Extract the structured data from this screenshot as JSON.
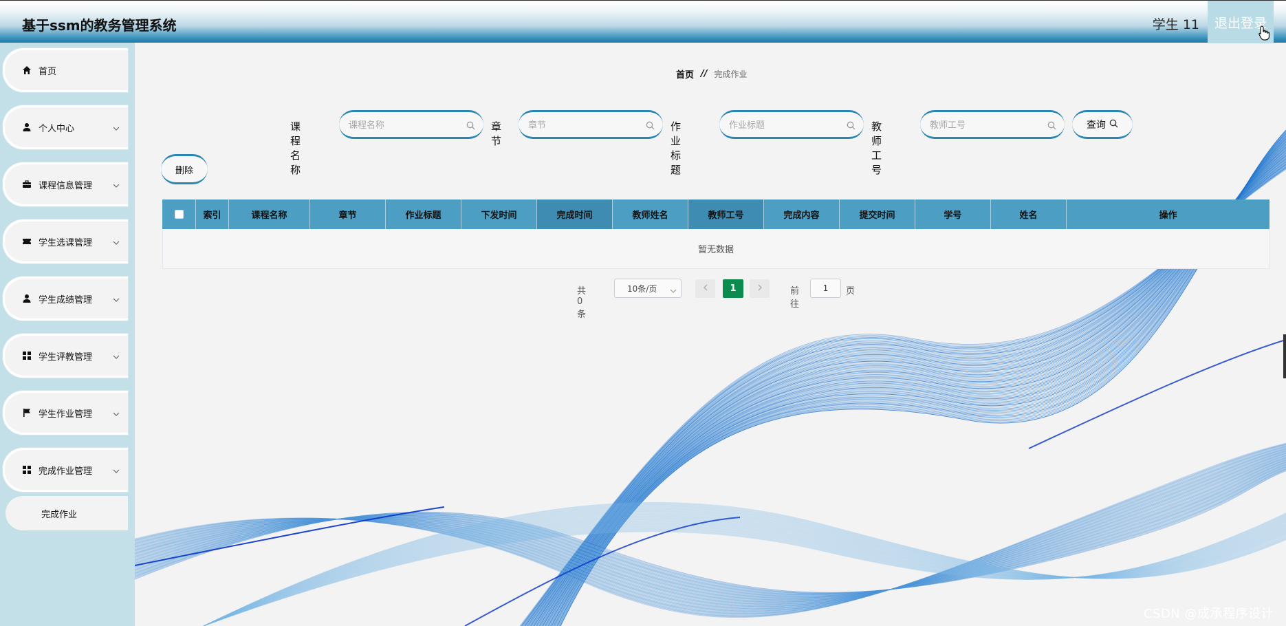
{
  "header": {
    "title": "基于ssm的教务管理系统",
    "user": "学生 11",
    "logout": "退出登录"
  },
  "sidebar": {
    "items": [
      {
        "label": "首页",
        "icon": "home-icon"
      },
      {
        "label": "个人中心",
        "icon": "user-icon"
      },
      {
        "label": "课程信息管理",
        "icon": "briefcase-icon"
      },
      {
        "label": "学生选课管理",
        "icon": "ticket-icon"
      },
      {
        "label": "学生成绩管理",
        "icon": "user-icon"
      },
      {
        "label": "学生评教管理",
        "icon": "grid-icon"
      },
      {
        "label": "学生作业管理",
        "icon": "flag-icon"
      },
      {
        "label": "完成作业管理",
        "icon": "grid-icon"
      }
    ],
    "submenu": {
      "label": "完成作业"
    }
  },
  "breadcrumb": {
    "home": "首页",
    "sep": "//",
    "current": "完成作业"
  },
  "search": {
    "course_label": "课程名称",
    "course_placeholder": "课程名称",
    "chapter_label": "章节",
    "chapter_placeholder": "章节",
    "title_label": "作业标题",
    "title_placeholder": "作业标题",
    "teacher_label": "教师工号",
    "teacher_placeholder": "教师工号",
    "query": "查询"
  },
  "actions": {
    "delete": "删除"
  },
  "table": {
    "columns": [
      "索引",
      "课程名称",
      "章节",
      "作业标题",
      "下发时间",
      "完成时间",
      "教师姓名",
      "教师工号",
      "完成内容",
      "提交时间",
      "学号",
      "姓名",
      "操作"
    ],
    "empty": "暂无数据"
  },
  "pagination": {
    "total": "共 0 条",
    "page_size": "10条/页",
    "current_page": "1",
    "goto_label": "前往",
    "goto_value": "1",
    "page_unit": "页"
  },
  "watermark": "CSDN @成承程序设计",
  "colors": {
    "accent": "#2a86b3",
    "table_header": "#4c9fc3",
    "active_page": "#0c8b4f"
  }
}
